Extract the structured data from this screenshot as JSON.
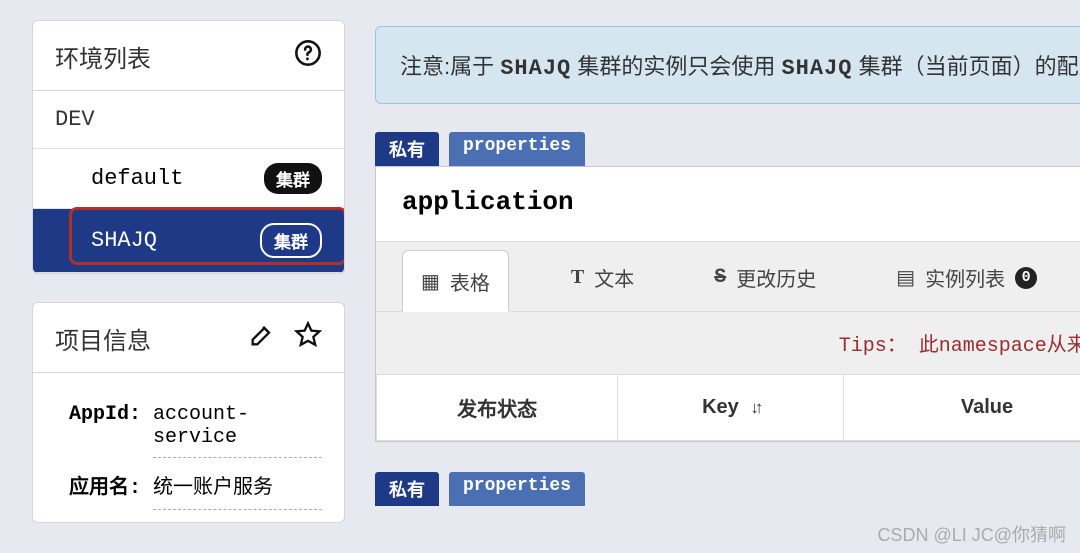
{
  "sidebar": {
    "env_list_title": "环境列表",
    "env_name": "DEV",
    "clusters": [
      {
        "name": "default",
        "badge": "集群",
        "selected": false
      },
      {
        "name": "SHAJQ",
        "badge": "集群",
        "selected": true
      }
    ],
    "project_info_title": "项目信息",
    "project": {
      "appid_label": "AppId:",
      "appid_value": "account-service",
      "appname_label": "应用名:",
      "appname_value": "统一账户服务"
    }
  },
  "main": {
    "notice_prefix": "注意:属于 ",
    "notice_cluster1": "SHAJQ",
    "notice_mid": " 集群的实例只会使用 ",
    "notice_cluster2": "SHAJQ",
    "notice_suffix": " 集群（当前页面）的配置,",
    "ns": {
      "tag_private": "私有",
      "tag_props": "properties",
      "title": "application",
      "tabs": {
        "grid": "表格",
        "text": "文本",
        "history": "更改历史",
        "instances": "实例列表",
        "instances_count": "0"
      },
      "tips": "Tips： 此namespace从来没",
      "columns": {
        "status": "发布状态",
        "key": "Key",
        "value": "Value"
      }
    },
    "ns2": {
      "tag_private": "私有",
      "tag_props": "properties"
    }
  },
  "watermark": "CSDN @LI JC@你猜啊"
}
